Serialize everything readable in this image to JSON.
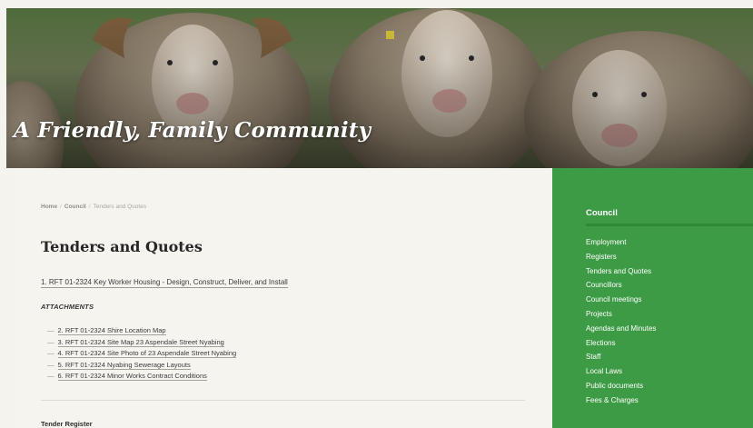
{
  "hero": {
    "title": "A Friendly, Family Community"
  },
  "breadcrumb": {
    "home": "Home",
    "sep": "/",
    "council": "Council",
    "current": "Tenders and Quotes"
  },
  "main": {
    "title": "Tenders and Quotes",
    "primary_link": "1. RFT 01-2324 Key Worker Housing - Design, Construct, Deliver, and Install",
    "attachments_heading": "ATTACHMENTS",
    "attachments": [
      "2. RFT 01-2324 Shire Location Map",
      "3. RFT 01-2324 Site Map 23 Aspendale Street Nyabing",
      "4. RFT 01-2324 Site Photo of 23 Aspendale Street Nyabing",
      "5. RFT 01-2324 Nyabing Sewerage Layouts",
      "6. RFT 01-2324 Minor Works Contract Conditions"
    ],
    "register_heading": "Tender Register"
  },
  "sidebar": {
    "title": "Council",
    "items": [
      "Employment",
      "Registers",
      "Tenders and Quotes",
      "Councillors",
      "Council meetings",
      "Projects",
      "Agendas and Minutes",
      "Elections",
      "Staff",
      "Local Laws",
      "Public documents",
      "Fees & Charges"
    ]
  },
  "colors": {
    "sidebar_green": "#3d9a45",
    "page_background": "#f4f3ee",
    "heading_text": "#262626"
  }
}
